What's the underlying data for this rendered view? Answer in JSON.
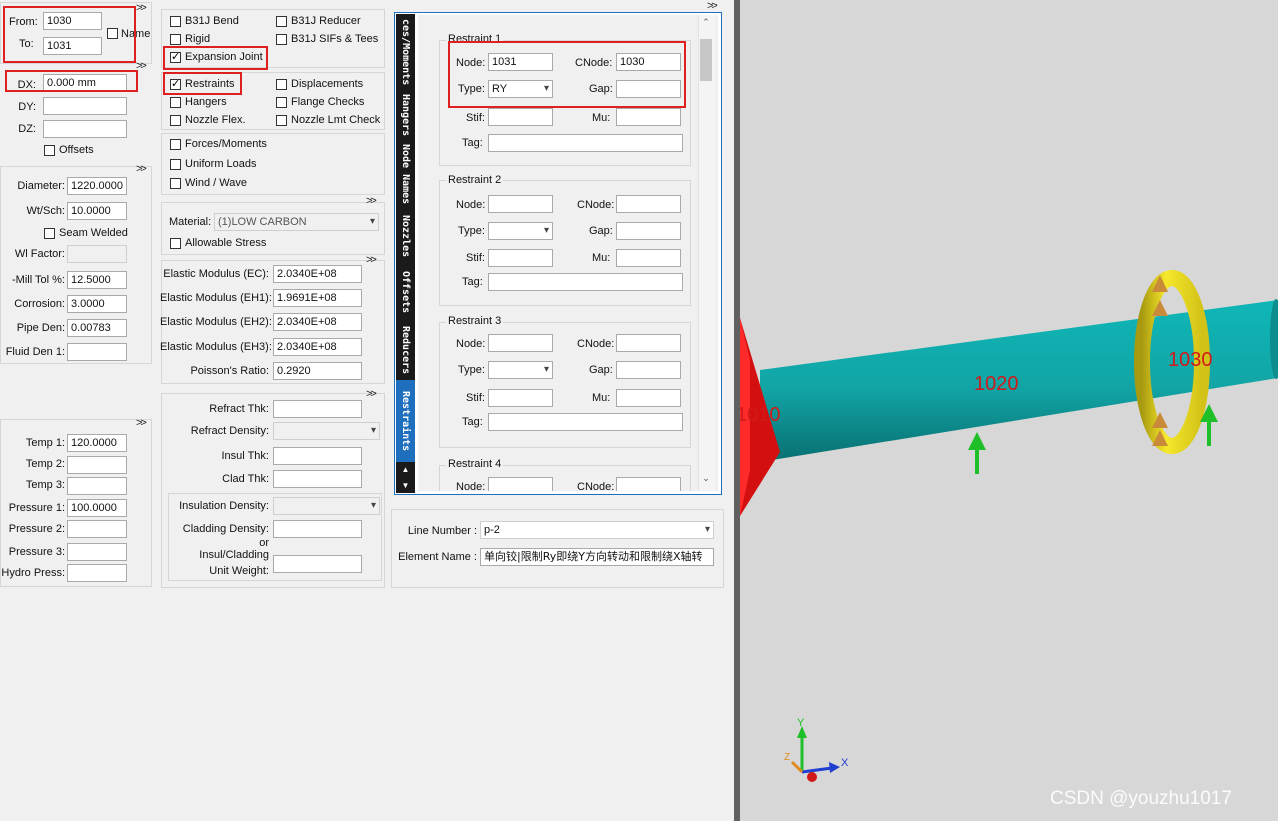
{
  "top_panel": {
    "from_label": "From:",
    "from_value": "1030",
    "to_label": "To:",
    "to_value": "1031",
    "name_label": "Name"
  },
  "expand_glyph": ">>",
  "deltas": {
    "dx_label": "DX:",
    "dx_value": "0.000 mm",
    "dy_label": "DY:",
    "dz_label": "DZ:",
    "offsets_label": "Offsets"
  },
  "pipe": {
    "diameter_label": "Diameter:",
    "diameter": "1220.0000",
    "wt_label": "Wt/Sch:",
    "wt": "10.0000",
    "seam_label": "Seam Welded",
    "wl_label": "Wl Factor:",
    "mill_label": "-Mill Tol %:",
    "mill": "12.5000",
    "corrosion_label": "Corrosion:",
    "corrosion": "3.0000",
    "pipe_den_label": "Pipe Den:",
    "pipe_den": "0.00783",
    "fluid_den_label": "Fluid Den 1:"
  },
  "temps": {
    "t1_label": "Temp 1:",
    "t1": "120.0000",
    "t2_label": "Temp 2:",
    "t3_label": "Temp 3:",
    "p1_label": "Pressure 1:",
    "p1": "100.0000",
    "p2_label": "Pressure 2:",
    "p3_label": "Pressure 3:",
    "hydro_label": "Hydro Press:"
  },
  "checks": {
    "b31j_bend": "B31J Bend",
    "b31j_reducer": "B31J Reducer",
    "rigid": "Rigid",
    "b31j_sifs": "B31J SIFs & Tees",
    "expansion_joint": "Expansion Joint",
    "restraints": "Restraints",
    "displacements": "Displacements",
    "hangers": "Hangers",
    "flange_checks": "Flange Checks",
    "nozzle_flex": "Nozzle Flex.",
    "nozzle_lmt": "Nozzle Lmt Check",
    "forces": "Forces/Moments",
    "uniform": "Uniform Loads",
    "wind": "Wind / Wave"
  },
  "material": {
    "label": "Material:",
    "value": "(1)LOW CARBON",
    "allowable_label": "Allowable Stress"
  },
  "elastic": {
    "ec_label": "Elastic Modulus (EC):",
    "ec": "2.0340E+08",
    "eh1_label": "Elastic Modulus (EH1):",
    "eh1": "1.9691E+08",
    "eh2_label": "Elastic Modulus (EH2):",
    "eh2": "2.0340E+08",
    "eh3_label": "Elastic Modulus (EH3):",
    "eh3": "2.0340E+08",
    "poisson_label": "Poisson's Ratio:",
    "poisson": "0.2920"
  },
  "insulation": {
    "refract_thk": "Refract Thk:",
    "refract_den": "Refract Density:",
    "insul_thk": "Insul Thk:",
    "clad_thk": "Clad Thk:",
    "insul_den": "Insulation Density:",
    "clad_den": "Cladding Density:",
    "or": "or",
    "unit_weight_1": "Insul/Cladding",
    "unit_weight_2": "Unit Weight:"
  },
  "tabs": [
    "ces/Moments",
    "Hangers",
    "Node Names",
    "Nozzles",
    "Offsets",
    "Reducers",
    "Restraints"
  ],
  "restraint_labels": {
    "node": "Node:",
    "cnode": "CNode:",
    "type": "Type:",
    "gap": "Gap:",
    "stif": "Stif:",
    "mu": "Mu:",
    "tag": "Tag:"
  },
  "restraints": [
    {
      "title": "Restraint 1",
      "node": "1031",
      "cnode": "1030",
      "type": "RY"
    },
    {
      "title": "Restraint 2",
      "node": "",
      "cnode": "",
      "type": ""
    },
    {
      "title": "Restraint 3",
      "node": "",
      "cnode": "",
      "type": ""
    },
    {
      "title": "Restraint 4"
    }
  ],
  "bottom": {
    "line_label": "Line Number :",
    "line_value": "p-2",
    "elem_label": "Element Name :",
    "elem_value": "单向铰|限制Ry即绕Y方向转动和限制绕X轴转"
  },
  "viewport": {
    "node_1010": "1010",
    "node_1020": "1020",
    "node_1030": "1030",
    "axis_x": "X",
    "axis_y": "Y",
    "axis_z": "Z",
    "watermark": "CSDN @youzhu1017"
  },
  "colors": {
    "pipe": "#12a7a8",
    "anchor": "#e01010",
    "ring": "#f2e21a",
    "arrow": "#1fbf2a",
    "highlight": "#e02020",
    "tab_active": "#1f6fbf"
  }
}
